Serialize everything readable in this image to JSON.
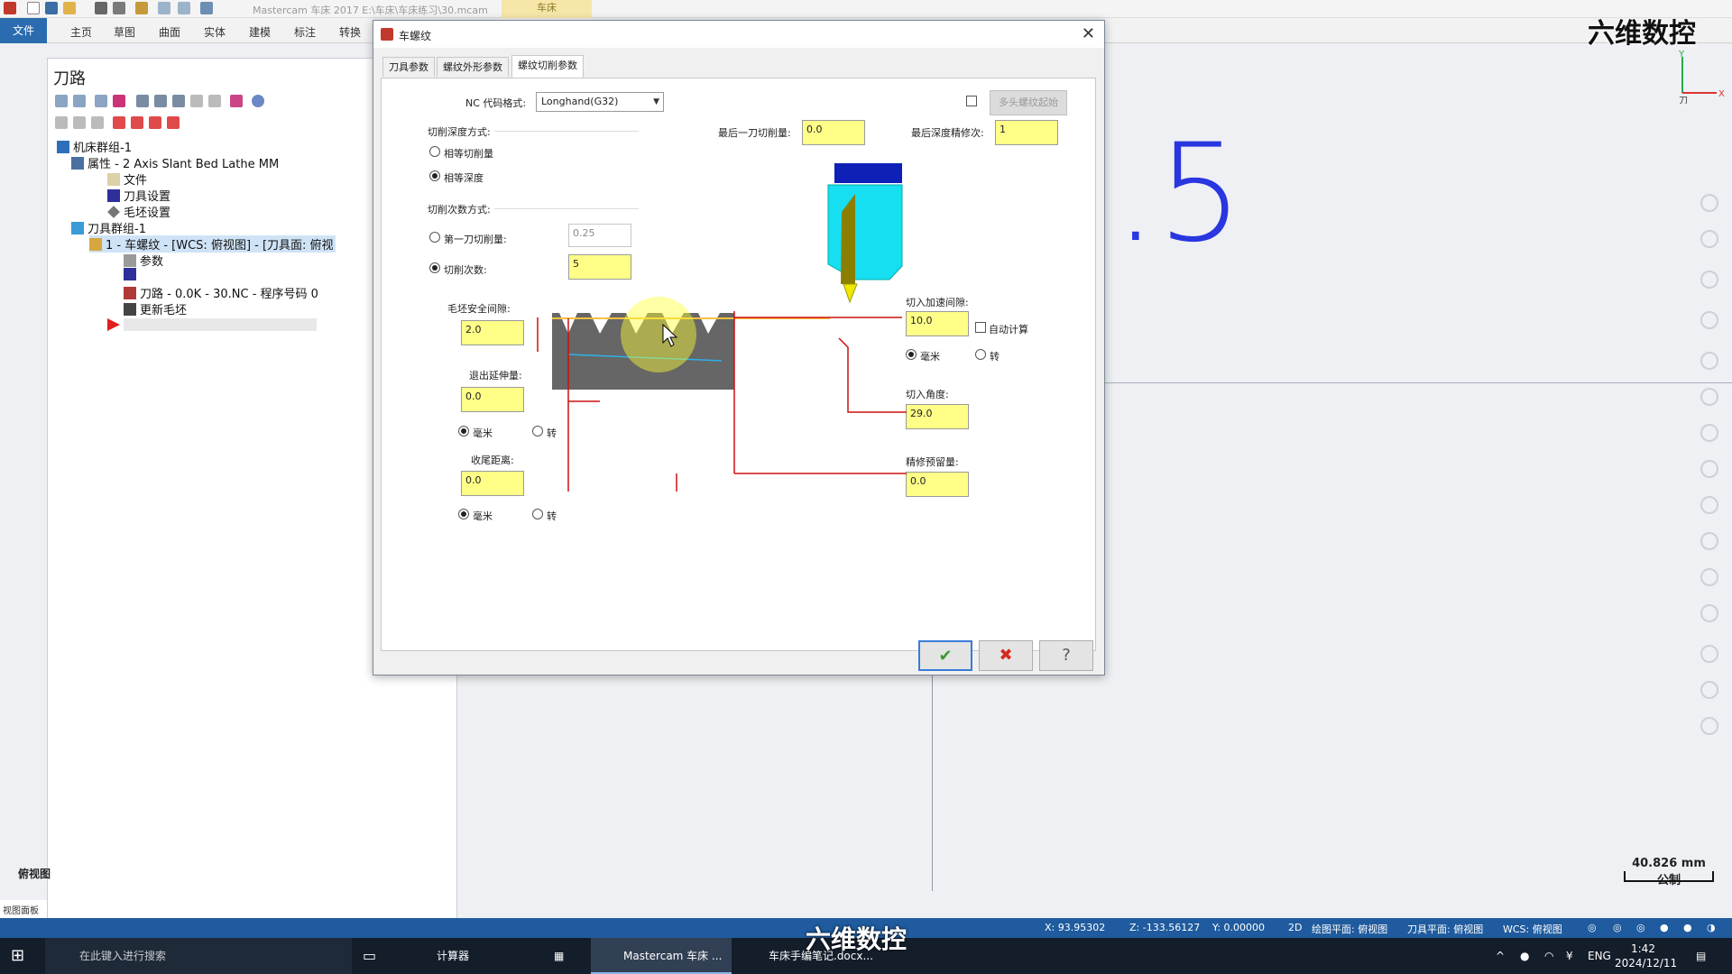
{
  "app": {
    "title": "Mastercam 车床 2017  E:\\车床\\车床练习\\30.mcam",
    "context_tab": "车床"
  },
  "ribbon": {
    "tabs": [
      "文件",
      "主页",
      "草图",
      "曲面",
      "实体",
      "建模",
      "标注",
      "转换"
    ]
  },
  "toolpath_panel": {
    "title": "刀路",
    "tree": {
      "machine_group": "机床群组-1",
      "properties": "属性 - 2 Axis Slant Bed Lathe MM",
      "files": "文件",
      "tool_settings": "刀具设置",
      "stock_settings": "毛坯设置",
      "toolpath_group": "刀具群组-1",
      "operation": "1 - 车螺纹 - [WCS: 俯视图] - [刀具面: 俯视",
      "params": "参数",
      "toolpath": "刀路 - 0.0K - 30.NC - 程序号码 0",
      "update_stock": "更新毛坯"
    },
    "view_tab": "俯视图",
    "bottom_label": "视图面板"
  },
  "dialog": {
    "title": "车螺纹",
    "tabs": [
      "刀具参数",
      "螺纹外形参数",
      "螺纹切削参数"
    ],
    "active_tab": "螺纹切削参数",
    "nc_format_label": "NC 代码格式:",
    "nc_format_value": "Longhand(G32)",
    "multi_start_button": "多头螺纹起始",
    "cut_depth_method_label": "切削深度方式:",
    "equal_area": "相等切削量",
    "equal_depth": "相等深度",
    "num_cuts_method_label": "切削次数方式:",
    "first_cut_amount": "第一刀切削量:",
    "first_cut_value": "0.25",
    "num_cuts": "切削次数:",
    "num_cuts_value": "5",
    "last_cut_amount_label": "最后一刀切削量:",
    "last_cut_amount_value": "0.0",
    "last_depth_passes_label": "最后深度精修次:",
    "last_depth_passes_value": "1",
    "stock_clearance_label": "毛坯安全间隙:",
    "stock_clearance_value": "2.0",
    "exit_extension_label": "退出延伸量:",
    "exit_extension_value": "0.0",
    "unit_mm": "毫米",
    "unit_rev": "转",
    "runout_label": "收尾距离:",
    "runout_value": "0.0",
    "accel_clearance_label": "切入加速间隙:",
    "accel_clearance_value": "10.0",
    "auto_compute": "自动计算",
    "infeed_angle_label": "切入角度:",
    "infeed_angle_value": "29.0",
    "finish_stock_label": "精修预留量:",
    "finish_stock_value": "0.0"
  },
  "statusbar": {
    "x": "X: 93.95302",
    "z": "Z: -133.56127",
    "y": "Y: 0.00000",
    "mode": "2D",
    "cplane": "绘图平面: 俯视图",
    "tplane": "刀具平面: 俯视图",
    "wcs": "WCS: 俯视图"
  },
  "graphics": {
    "big_text": ".5",
    "scale_value": "40.826 mm",
    "scale_unit": "公制",
    "axis_y": "Y",
    "axis_x": "X",
    "axis_knife": "刀"
  },
  "taskbar": {
    "search_placeholder": "在此键入进行搜索",
    "apps": [
      "计算器",
      "Mastercam 车床 ...",
      "车床手编笔记.docx..."
    ],
    "lang": "ENG",
    "time": "1:42",
    "date": "2024/12/11"
  },
  "watermark": "六维数控",
  "colors": {
    "accent_blue": "#2b6cb0",
    "statusbar": "#1f5b9e",
    "input_yellow": "#ffff88",
    "ok_green": "#3a9b2d",
    "cancel_red": "#d62b1f"
  }
}
